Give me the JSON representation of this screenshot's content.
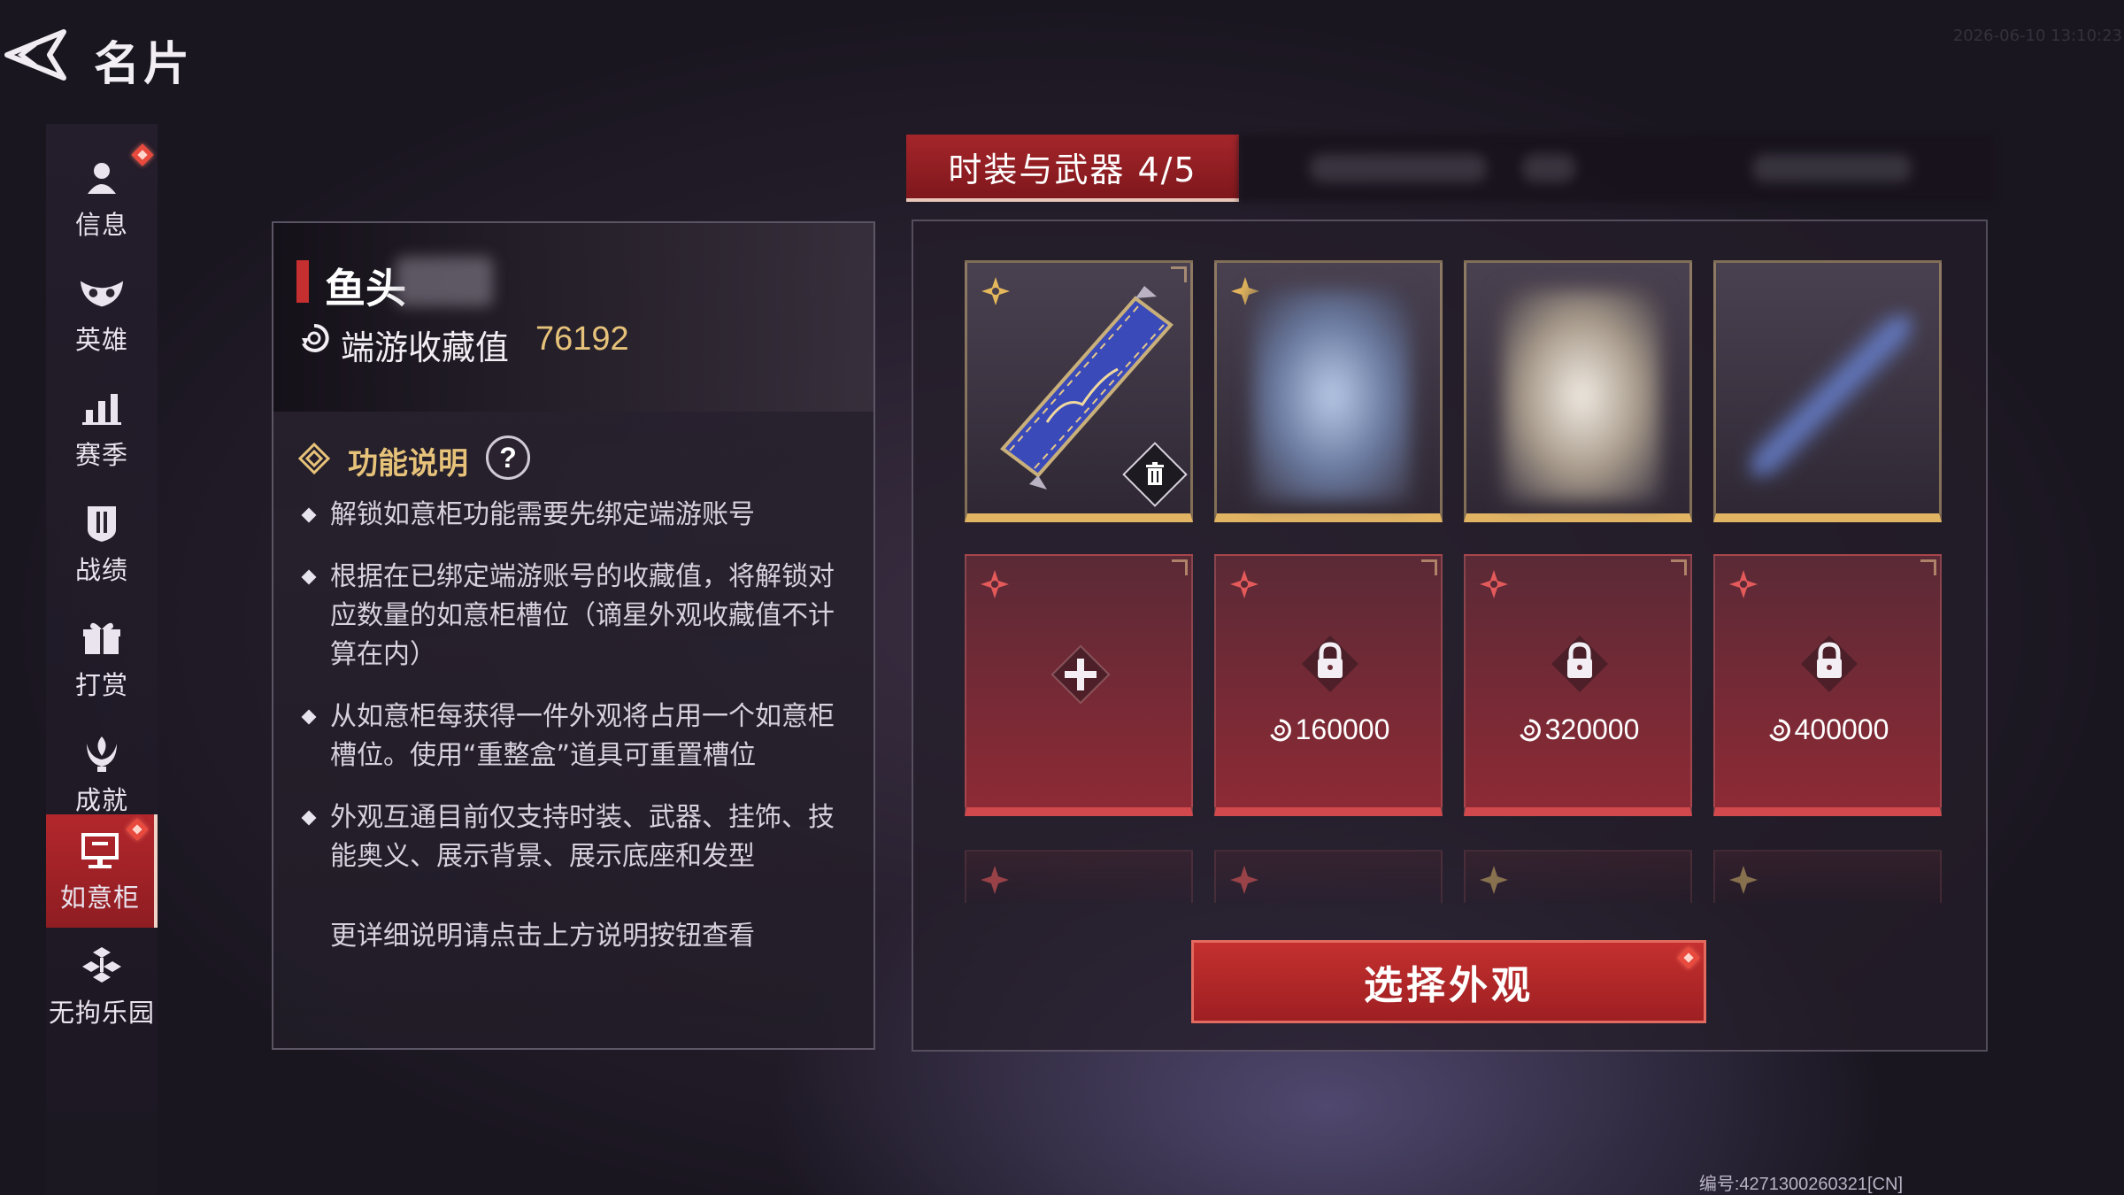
{
  "header": {
    "title": "名片",
    "timestamp": "2026-06-10 13:10:23",
    "footer_id": "编号:4271300260321[CN]"
  },
  "sidebar": {
    "items": [
      {
        "label": "信息",
        "icon": "user-icon",
        "badge": true
      },
      {
        "label": "英雄",
        "icon": "mask-icon",
        "badge": false
      },
      {
        "label": "赛季",
        "icon": "bar-chart-icon",
        "badge": false
      },
      {
        "label": "战绩",
        "icon": "shield-icon",
        "badge": false
      },
      {
        "label": "打赏",
        "icon": "gift-icon",
        "badge": false
      },
      {
        "label": "成就",
        "icon": "trophy-icon",
        "badge": false
      },
      {
        "label": "如意柜",
        "icon": "cabinet-icon",
        "badge": true,
        "active": true
      },
      {
        "label": "无拘乐园",
        "icon": "blocks-icon",
        "badge": false
      }
    ]
  },
  "profile": {
    "name": "鱼头",
    "collection_label": "端游收藏值",
    "collection_value": "76192"
  },
  "function_info": {
    "title": "功能说明",
    "help_label": "?",
    "items": [
      "解锁如意柜功能需要先绑定端游账号",
      "根据在已绑定端游账号的收藏值，将解锁对应数量的如意柜槽位（谪星外观收藏值不计算在内）",
      "从如意柜每获得一件外观将占用一个如意柜槽位。使用“重整盒”道具可重置槽位",
      "外观互通目前仅支持时装、武器、挂饰、技能奥义、展示背景、展示底座和发型"
    ],
    "footer": "更详细说明请点击上方说明按钮查看"
  },
  "tabs": {
    "active_label": "时装与武器 4/5"
  },
  "slots": {
    "locked_costs": [
      "160000",
      "320000",
      "400000"
    ]
  },
  "actions": {
    "select_label": "选择外观"
  },
  "colors": {
    "accent_red": "#b3272c",
    "gold": "#e1b464",
    "value_gold": "#e6c27a"
  }
}
